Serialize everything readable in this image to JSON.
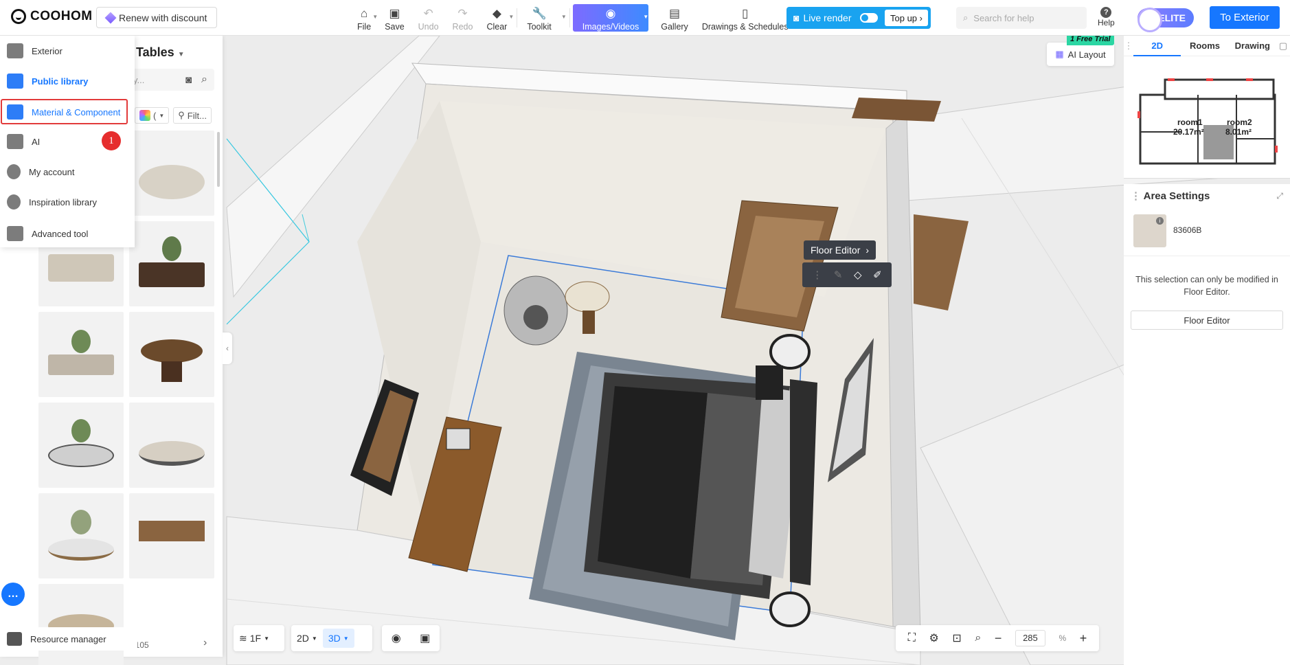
{
  "brand": {
    "name": "COOHOM",
    "renew_label": "Renew with discount"
  },
  "toolbar": {
    "file": "File",
    "save": "Save",
    "undo": "Undo",
    "redo": "Redo",
    "clear": "Clear",
    "toolkit": "Toolkit",
    "images_videos": "Images/Videos",
    "gallery": "Gallery",
    "drawings": "Drawings & Schedules"
  },
  "live_render": {
    "label": "Live render",
    "top_up": "Top up"
  },
  "help": {
    "search_placeholder": "Search for help",
    "label": "Help"
  },
  "membership": {
    "badge": "ELITE"
  },
  "to_exterior": "To Exterior",
  "catalog": {
    "title": "Tables",
    "search_placeholder": "y...",
    "color_chip": "(",
    "filter_label": "Filt...",
    "pagination": "/ 105"
  },
  "menu": {
    "items": [
      {
        "label": "Exterior"
      },
      {
        "label": "Public library"
      },
      {
        "label": "Material & Component"
      },
      {
        "label": "AI"
      },
      {
        "label": "My account"
      },
      {
        "label": "Inspiration library"
      },
      {
        "label": "Advanced tool"
      }
    ],
    "step_badge": "1",
    "resource_manager": "Resource manager"
  },
  "viewport": {
    "ai_layout": "AI Layout",
    "free_trial": "1 Free Trial",
    "floor_editor_tip": "Floor Editor"
  },
  "minimap": {
    "tabs": [
      "2D",
      "Rooms",
      "Drawing"
    ],
    "rooms": [
      {
        "name": "room1",
        "area": "20.17m²"
      },
      {
        "name": "room2",
        "area": "8.01m²"
      }
    ]
  },
  "area_settings": {
    "title": "Area Settings",
    "material_code": "83606B",
    "message": "This selection can only be modified in Floor Editor.",
    "button": "Floor Editor"
  },
  "bottom": {
    "floor": "1F",
    "view_2d": "2D",
    "view_3d": "3D",
    "zoom_value": "285",
    "zoom_unit": "%"
  },
  "colors": {
    "accent": "#1677ff",
    "live_render": "#19a3f0",
    "highlight": "#e23a3a"
  }
}
